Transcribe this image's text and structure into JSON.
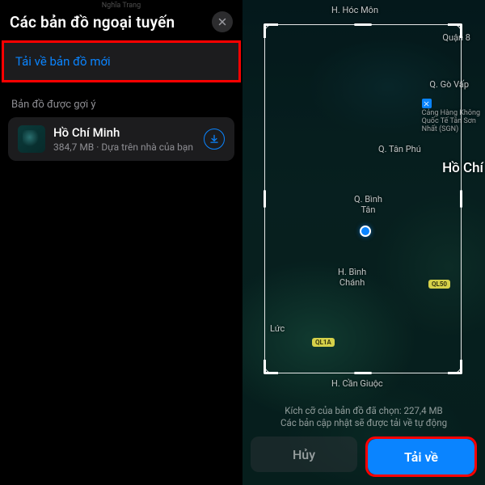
{
  "left": {
    "top_label": "Nghĩa Trang",
    "title": "Các bản đồ ngoại tuyến",
    "download_new": "Tải về bản đồ mới",
    "suggested_label": "Bản đồ được gợi ý",
    "suggestion": {
      "title": "Hồ Chí Minh",
      "subtitle": "384,7 MB · Dựa trên nhà của bạn"
    }
  },
  "right": {
    "labels": {
      "hoc_mon": "H. Hóc Môn",
      "quan8": "Quận 8",
      "go_vap": "Q. Gò Vấp",
      "airport": "Cảng Hàng Không\nQuốc Tế Tân Sơn\nNhất (SGN)",
      "tan_phu": "Q. Tân Phú",
      "city": "Hồ Chí",
      "binh_tan": "Q. Bình\nTân",
      "binh_chanh": "H. Bình\nChánh",
      "luc": "Lức",
      "can_giuoc": "H. Cần Giuộc",
      "road1": "QL50",
      "road2": "QL1A"
    },
    "info1": "Kích cỡ của bản đồ đã chọn: 227,4 MB",
    "info2": "Các bản cập nhật sẽ được tải về tự động",
    "cancel": "Hủy",
    "download": "Tải về"
  }
}
